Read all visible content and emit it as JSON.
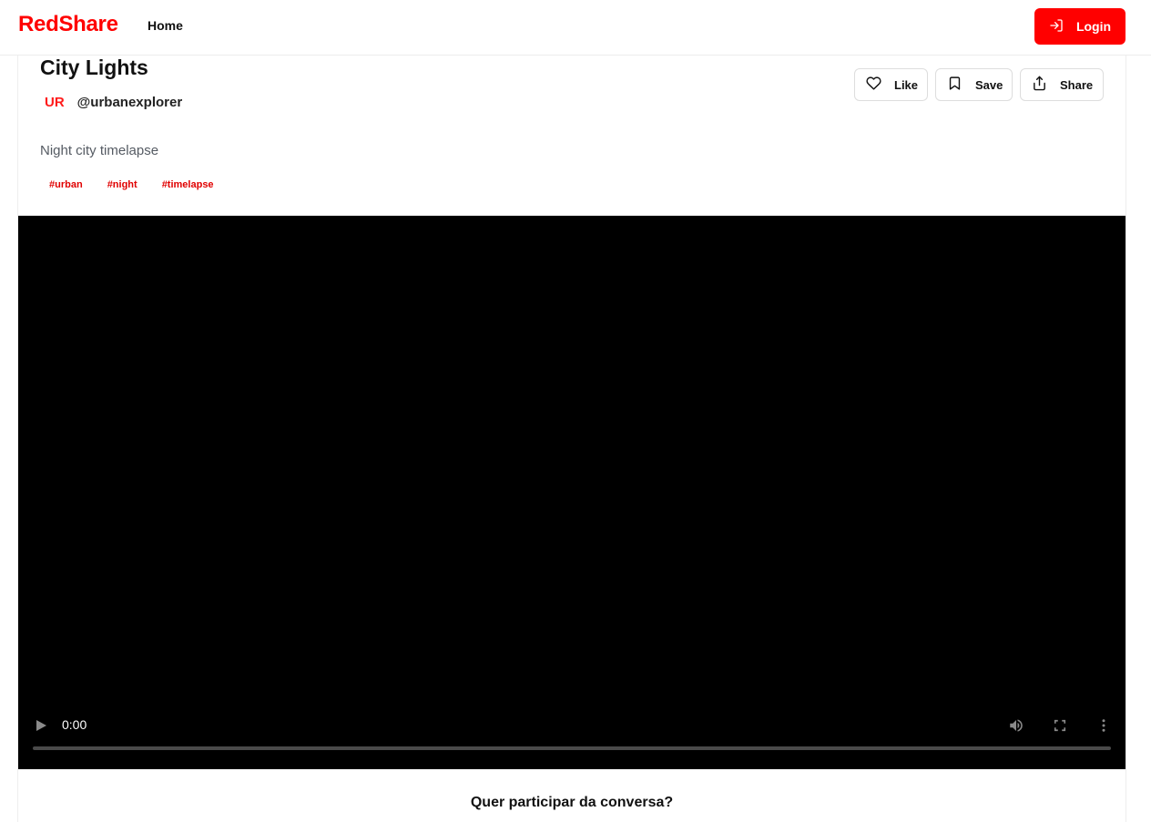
{
  "header": {
    "brand": "RedShare",
    "nav_home": "Home",
    "login_label": "Login"
  },
  "post": {
    "title": "City Lights",
    "avatar_initials": "UR",
    "username": "@urbanexplorer",
    "description": "Night city timelapse",
    "tags": [
      "#urban",
      "#night",
      "#timelapse"
    ],
    "actions": {
      "like": "Like",
      "save": "Save",
      "share": "Share"
    }
  },
  "video": {
    "current_time": "0:00",
    "progress": 0
  },
  "footer": {
    "join_prompt": "Quer participar da conversa?"
  },
  "colors": {
    "brand": "#ff0000",
    "tag": "#e00000",
    "video_bg": "#000000"
  },
  "icons": {
    "login": "login-icon",
    "like": "heart-icon",
    "save": "bookmark-icon",
    "share": "share-icon",
    "play": "play-icon",
    "volume": "volume-icon",
    "fullscreen": "fullscreen-icon",
    "more": "more-vertical-icon"
  }
}
